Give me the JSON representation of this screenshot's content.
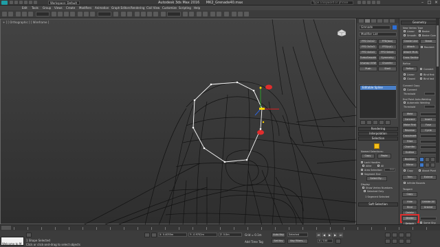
{
  "titlebar": {
    "workspace": "Workspace: Default",
    "app": "Autodesk 3ds Max 2016",
    "file": "MK2_Grenade40.max",
    "search_placeholder": "Type a keyword or phrase"
  },
  "menu": [
    "Edit",
    "Tools",
    "Group",
    "Views",
    "Create",
    "Modifiers",
    "Animation",
    "Graph Editors",
    "Rendering",
    "Civil View",
    "Customize",
    "Scripting",
    "Help"
  ],
  "viewport": {
    "label": "+ ] [ Orthographic ] [ Wireframe ]"
  },
  "panel": {
    "object_name": "Grenade",
    "modifier_list": "Modifier List",
    "modifier_buttons": [
      "FFD 2x2x2",
      "FFD(box)",
      "FFD 3x3x3",
      "FFD(cyl)",
      "FFD 4x4x4",
      "FFD Select",
      "TurboSmooth",
      "Symmetry",
      "Unwrap UVW",
      "Chamfer",
      "Push",
      "Shell"
    ],
    "stack_item": "Editable Spline",
    "rollouts": [
      "Rendering",
      "Interpolation",
      "Selection"
    ],
    "named_selections_label": "Named Selections:",
    "copy_btn": "Copy",
    "paste_btn": "Paste",
    "lock_handles": "Lock Handles",
    "alike": "Alike",
    "all": "All",
    "area_selection": "Area Selection:",
    "area_value": "0.1",
    "segment_end": "Segment End",
    "select_by": "Select By...",
    "display_label": "Display",
    "show_vertex_numbers": "Show Vertex Numbers",
    "selected_only": "Selected Only",
    "selected_status": "1 Segment Selected",
    "soft_selection": "Soft Selection"
  },
  "panel2": {
    "geometry": "Geometry",
    "new_vertex_type": "New Vertex Type",
    "linear": "Linear",
    "bezier": "Bezier",
    "smooth": "Smooth",
    "bezier_corner": "Bezier Corner",
    "create_line": "Create Line",
    "break": "Break",
    "attach": "Attach",
    "reorient": "Reorient",
    "attach_mult": "Attach Mult.",
    "cross_section": "Cross Section",
    "refine": "Refine",
    "connect": "Connect",
    "linear2": "Linear",
    "bind_first": "Bind first",
    "closed": "Closed",
    "bind_last": "Bind last",
    "connect_copy": "Connect Copy",
    "connect_label": "Connect",
    "threshold": "Threshold",
    "end_point_auto": "End Point Auto-Welding",
    "auto_welding": "Automatic Welding",
    "threshold_dist": "Threshold",
    "weld": "Weld",
    "connect2": "Connect",
    "insert": "Insert",
    "make_first": "Make First",
    "fuse": "Fuse",
    "reverse": "Reverse",
    "cycle": "Cycle",
    "crossinsert": "CrossInsert",
    "fillet": "Fillet",
    "chamfer": "Chamfer",
    "outline": "Outline",
    "boolean": "Boolean",
    "mirror": "Mirror",
    "copy": "Copy",
    "about_pivot": "About Pivot",
    "trim": "Trim",
    "extend": "Extend",
    "infinite_bounds": "Infinite Bounds",
    "tangent": "Tangent",
    "hide": "Hide",
    "unhide_all": "Unhide All",
    "bind": "Bind",
    "unbind": "Unbind",
    "delete": "Delete",
    "close": "Close",
    "divide": "Divide",
    "detach": "Detach",
    "same_shp": "Same Shp",
    "reorient2": "Reorient",
    "explode": "Explode",
    "to_splines": "Splines",
    "to_objects": "Objects",
    "copy2": "Copy"
  },
  "timeline": {
    "frame": "0 / 100"
  },
  "status": {
    "listener": "Welcome to M",
    "selected": "1 Shape Selected",
    "prompt": "Click or click-and-drag to select objects",
    "x": "X: 0.4055m",
    "y": "Y: -0.9702m",
    "z": "Z: 0.0m",
    "grid": "Grid = 0.1m",
    "add_time_tag": "Add Time Tag",
    "auto_key": "Auto Key",
    "selected_dd": "Selected",
    "set_key": "Set Key",
    "key_filters": "Key Filters..."
  },
  "colors": {
    "wire_color": "#0c0c0c",
    "spline_color": "#ffffff",
    "highlight_red": "#e02d2d"
  }
}
